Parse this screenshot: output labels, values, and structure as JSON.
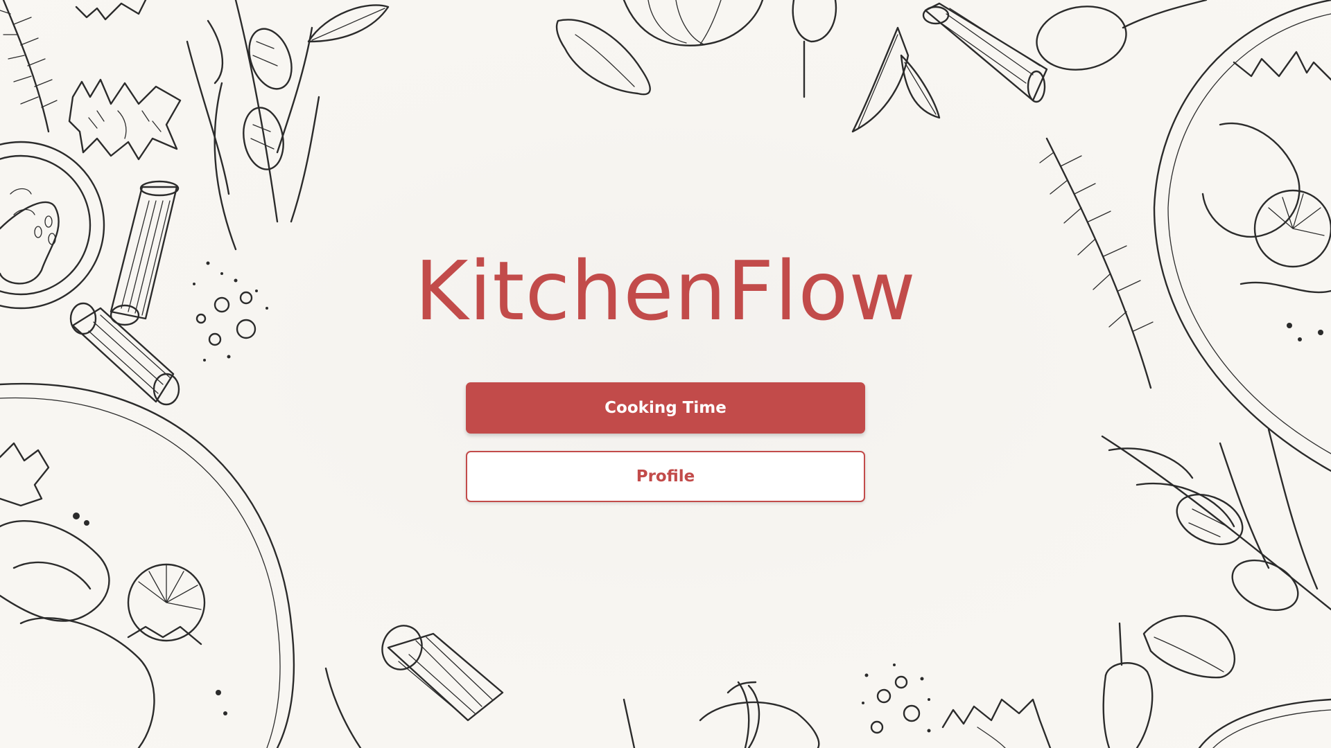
{
  "app": {
    "title": "KitchenFlow"
  },
  "menu": {
    "primary_label": "Cooking Time",
    "secondary_label": "Profile"
  },
  "theme": {
    "accent": "#c24b4a",
    "background": "#f8f6f2",
    "ink": "#2b2b2b"
  }
}
